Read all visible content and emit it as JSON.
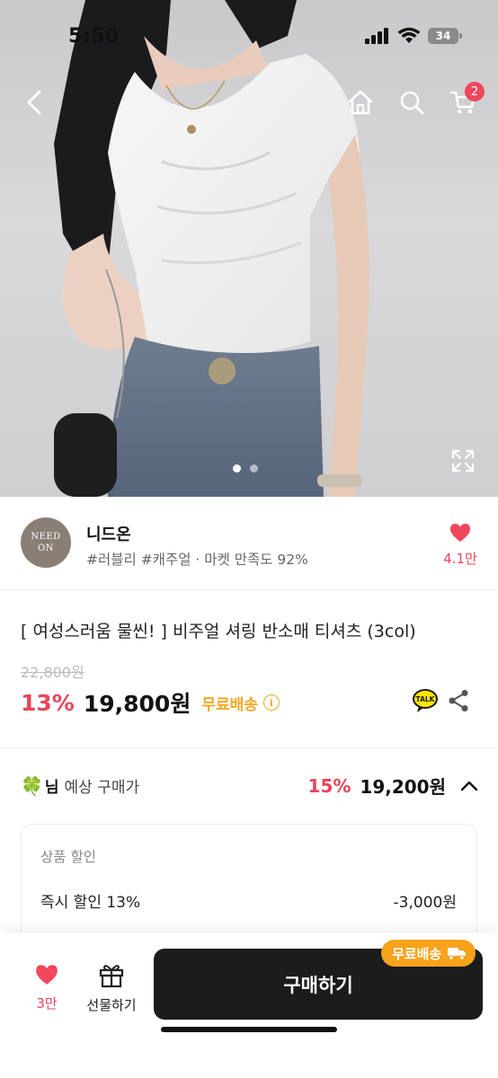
{
  "status_bar": {
    "time": "5:50",
    "battery": "34"
  },
  "nav": {
    "back_icon": "chevron-left-icon",
    "home_icon": "home-icon",
    "search_icon": "search-icon",
    "cart_icon": "cart-icon",
    "cart_badge": "2"
  },
  "gallery": {
    "total_images": 2,
    "active_index": 0,
    "expand_icon": "expand-icon"
  },
  "store": {
    "logo_line1": "NEED",
    "logo_line2": "ON",
    "name": "니드온",
    "tags": "#러블리 #캐주얼 · 마켓 만족도 92%",
    "favorites": "4.1만"
  },
  "product": {
    "title": "[ 여성스러움 물씬! ] 비주얼 셔링 반소매 티셔츠 (3col)",
    "original_price": "22,800원",
    "discount": "13%",
    "price": "19,800원",
    "free_shipping": "무료배송",
    "talk_label": "TALK"
  },
  "expected": {
    "emoji": "🍀",
    "nim": "님",
    "label": "예상 구매가",
    "discount": "15%",
    "price": "19,200원"
  },
  "discount_box": {
    "heading": "상품 할인",
    "line_label": "즉시 할인 13%",
    "line_value": "-3,000원"
  },
  "bottom_bar": {
    "like_count": "3만",
    "gift_label": "선물하기",
    "buy_label": "구매하기",
    "ship_tag": "무료배송"
  },
  "colors": {
    "accent_pink": "#e8455b",
    "shipping_orange": "#f5a623",
    "buy_button": "#1c1c1c"
  }
}
